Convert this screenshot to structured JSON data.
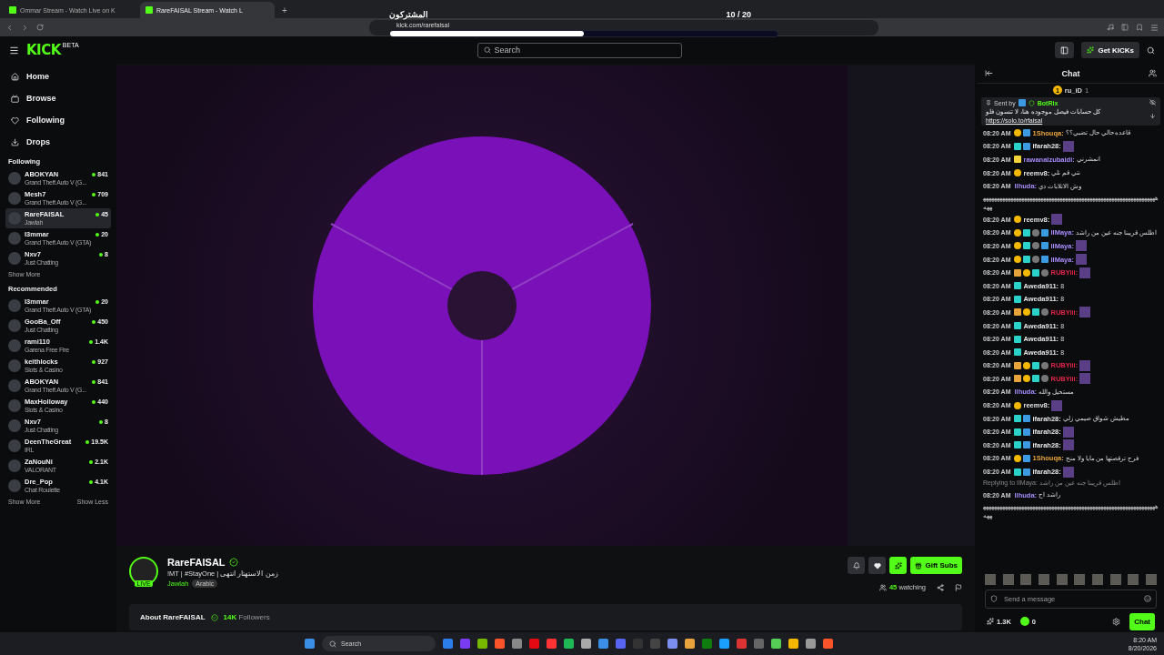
{
  "browser": {
    "tabs": [
      {
        "title": "Ommar Stream - Watch Live on K",
        "selected": false
      },
      {
        "title": "RareFAISAL Stream - Watch L",
        "selected": true
      }
    ],
    "new_tab": "+",
    "url": "kick.com/rarefaisal"
  },
  "overlay": {
    "label": "المشتركون",
    "count": "10 / 20",
    "level": 0.5
  },
  "header": {
    "logo": "KICK",
    "logo_tag": "BETA",
    "search": {
      "placeholder": "Search"
    },
    "get_kicks": "Get KICKs"
  },
  "sidebar": {
    "nav": [
      {
        "label": "Home"
      },
      {
        "label": "Browse"
      },
      {
        "label": "Following"
      },
      {
        "label": "Drops"
      }
    ],
    "following_title": "Following",
    "following": [
      {
        "name": "ABOKYAN",
        "category": "Grand Theft Auto V (G...",
        "viewers": "841",
        "selected": false
      },
      {
        "name": "Mesh7",
        "category": "Grand Theft Auto V (G...",
        "viewers": "709",
        "selected": false
      },
      {
        "name": "RareFAISAL",
        "category": "Jawlah",
        "viewers": "45",
        "selected": true
      },
      {
        "name": "I3mmar",
        "category": "Grand Theft Auto V (GTA)",
        "viewers": "20",
        "selected": false
      },
      {
        "name": "Nxv7",
        "category": "Just Chatting",
        "viewers": "8",
        "selected": false
      }
    ],
    "following_more": "Show More",
    "recommended_title": "Recommended",
    "recommended": [
      {
        "name": "I3mmar",
        "category": "Grand Theft Auto V (GTA)",
        "viewers": "20",
        "selected": false
      },
      {
        "name": "GooBa_Off",
        "category": "Just Chatting",
        "viewers": "450",
        "selected": false
      },
      {
        "name": "rami110",
        "category": "Garena Free Fire",
        "viewers": "1.4K",
        "selected": false
      },
      {
        "name": "keithlocks",
        "category": "Slots & Casino",
        "viewers": "927",
        "selected": false
      },
      {
        "name": "ABOKYAN",
        "category": "Grand Theft Auto V (G...",
        "viewers": "841",
        "selected": false
      },
      {
        "name": "MaxHolloway",
        "category": "Slots & Casino",
        "viewers": "440",
        "selected": false
      },
      {
        "name": "Nxv7",
        "category": "Just Chatting",
        "viewers": "8",
        "selected": false
      },
      {
        "name": "DeenTheGreat",
        "category": "IRL",
        "viewers": "19.5K",
        "selected": false
      },
      {
        "name": "ZaNouNi",
        "category": "VALORANT",
        "viewers": "2.1K",
        "selected": false
      },
      {
        "name": "Dre_Pop",
        "category": "Chat Roulette",
        "viewers": "4.1K",
        "selected": false
      }
    ],
    "show_more": "Show More",
    "show_less": "Show Less"
  },
  "channel": {
    "name": "RareFAISAL",
    "live_badge": "LIVE",
    "title": "!MT | #StayOne | زمن الاستهتار انتهى",
    "category": "Jawlah",
    "tag": "Arabic",
    "gift_subs": "Gift Subs",
    "watching_count": "45",
    "watching_label": "watching",
    "about_title": "About RareFAISAL",
    "followers_count": "14K",
    "followers_label": "Followers"
  },
  "chat": {
    "title": "Chat",
    "leader": {
      "rank": "1",
      "name": "ru_iD",
      "count": "1"
    },
    "pinned": {
      "sent_by": "Sent by",
      "author": "BotRix",
      "text": "كل حسابات فيصل موجوده هنا، لا تنسون فلو",
      "link": "https://solo.to/rfaisal"
    },
    "messages": [
      {
        "kind": "chat",
        "time": "08:20 AM",
        "badges": [
          {
            "kind": "sub"
          },
          {
            "kind": "mod"
          }
        ],
        "user": "1Shouqa:",
        "color": "#e8a33d",
        "text": "قاعده حالي حال تضبي؟؟"
      },
      {
        "kind": "chat",
        "time": "08:20 AM",
        "badges": [
          {
            "kind": "og"
          },
          {
            "kind": "mod"
          }
        ],
        "user": "ifarah28:",
        "color": "#e6e6e6",
        "emote": true
      },
      {
        "kind": "chat",
        "time": "08:20 AM",
        "badges": [
          {
            "kind": "vip"
          }
        ],
        "user": "rawanalzubaidi:",
        "color": "#a78bfa",
        "text": "انمشرني"
      },
      {
        "kind": "chat",
        "time": "08:20 AM",
        "badges": [
          {
            "kind": "sub"
          }
        ],
        "user": "reemv8:",
        "color": "#e6e6e6",
        "text": "نتي قم نلي"
      },
      {
        "kind": "chat",
        "time": "08:20 AM",
        "user": "llhuda:",
        "color": "#a78bfa",
        "text": "وش الاتلابات دي"
      },
      {
        "kind": "plain",
        "text": "ههههههههههههههههههههههههههههههههههههههههههههههههههههههههههههههههههه"
      },
      {
        "kind": "chat",
        "time": "08:20 AM",
        "badges": [
          {
            "kind": "sub"
          }
        ],
        "user": "reemv8:",
        "color": "#e6e6e6",
        "emote": true
      },
      {
        "kind": "chat",
        "time": "08:20 AM",
        "badges": [
          {
            "kind": "sub"
          },
          {
            "kind": "og"
          },
          {
            "kind": "hat"
          },
          {
            "kind": "mod"
          }
        ],
        "user": "IIMaya:",
        "color": "#a78bfa",
        "text": "اطلس قريبنا جنه عين من راشد"
      },
      {
        "kind": "chat",
        "time": "08:20 AM",
        "badges": [
          {
            "kind": "sub"
          },
          {
            "kind": "og"
          },
          {
            "kind": "hat"
          },
          {
            "kind": "mod"
          }
        ],
        "user": "IIMaya:",
        "color": "#a78bfa",
        "emote": true
      },
      {
        "kind": "chat",
        "time": "08:20 AM",
        "badges": [
          {
            "kind": "sub"
          },
          {
            "kind": "og"
          },
          {
            "kind": "hat"
          },
          {
            "kind": "mod"
          }
        ],
        "user": "IIMaya:",
        "color": "#a78bfa",
        "emote": true
      },
      {
        "kind": "chat",
        "time": "08:20 AM",
        "badges": [
          {
            "kind": "crown"
          },
          {
            "kind": "sub"
          },
          {
            "kind": "og"
          },
          {
            "kind": "hat"
          }
        ],
        "user": "RUBYiii:",
        "color": "#e0264a",
        "emote": true
      },
      {
        "kind": "chat",
        "time": "08:20 AM",
        "badges": [
          {
            "kind": "tw"
          }
        ],
        "user": "Aweda911:",
        "color": "#e6e6e6",
        "text": "8"
      },
      {
        "kind": "chat",
        "time": "08:20 AM",
        "badges": [
          {
            "kind": "tw"
          }
        ],
        "user": "Aweda911:",
        "color": "#e6e6e6",
        "text": "8"
      },
      {
        "kind": "chat",
        "time": "08:20 AM",
        "badges": [
          {
            "kind": "crown"
          },
          {
            "kind": "sub"
          },
          {
            "kind": "og"
          },
          {
            "kind": "hat"
          }
        ],
        "user": "RUBYiii:",
        "color": "#e0264a",
        "emote": true
      },
      {
        "kind": "chat",
        "time": "08:20 AM",
        "badges": [
          {
            "kind": "tw"
          }
        ],
        "user": "Aweda911:",
        "color": "#e6e6e6",
        "text": "8"
      },
      {
        "kind": "chat",
        "time": "08:20 AM",
        "badges": [
          {
            "kind": "tw"
          }
        ],
        "user": "Aweda911:",
        "color": "#e6e6e6",
        "text": "8"
      },
      {
        "kind": "chat",
        "time": "08:20 AM",
        "badges": [
          {
            "kind": "tw"
          }
        ],
        "user": "Aweda911:",
        "color": "#e6e6e6",
        "text": "8"
      },
      {
        "kind": "chat",
        "time": "08:20 AM",
        "badges": [
          {
            "kind": "crown"
          },
          {
            "kind": "sub"
          },
          {
            "kind": "og"
          },
          {
            "kind": "hat"
          }
        ],
        "user": "RUBYiii:",
        "color": "#e0264a",
        "emote": true
      },
      {
        "kind": "chat",
        "time": "08:20 AM",
        "badges": [
          {
            "kind": "crown"
          },
          {
            "kind": "sub"
          },
          {
            "kind": "og"
          },
          {
            "kind": "hat"
          }
        ],
        "user": "RUBYiii:",
        "color": "#e0264a",
        "emote": true
      },
      {
        "kind": "chat",
        "time": "08:20 AM",
        "user": "llhuda:",
        "color": "#a78bfa",
        "text": "مستحيل والله"
      },
      {
        "kind": "chat",
        "time": "08:20 AM",
        "badges": [
          {
            "kind": "sub"
          }
        ],
        "user": "reemv8:",
        "color": "#e6e6e6",
        "emote": true
      },
      {
        "kind": "chat",
        "time": "08:20 AM",
        "badges": [
          {
            "kind": "og"
          },
          {
            "kind": "mod"
          }
        ],
        "user": "ifarah28:",
        "color": "#e6e6e6",
        "text": "مطيش شواق صيمي زلي"
      },
      {
        "kind": "chat",
        "time": "08:20 AM",
        "badges": [
          {
            "kind": "og"
          },
          {
            "kind": "mod"
          }
        ],
        "user": "ifarah28:",
        "color": "#e6e6e6",
        "emote": true
      },
      {
        "kind": "chat",
        "time": "08:20 AM",
        "badges": [
          {
            "kind": "og"
          },
          {
            "kind": "mod"
          }
        ],
        "user": "ifarah28:",
        "color": "#e6e6e6",
        "emote": true
      },
      {
        "kind": "chat",
        "time": "08:20 AM",
        "badges": [
          {
            "kind": "sub"
          },
          {
            "kind": "mod"
          }
        ],
        "user": "1Shouqa:",
        "color": "#e8a33d",
        "text": "فرح ترقصتها من مايا ولا منح"
      },
      {
        "kind": "chat",
        "time": "08:20 AM",
        "badges": [
          {
            "kind": "og"
          },
          {
            "kind": "mod"
          }
        ],
        "user": "ifarah28:",
        "color": "#e6e6e6",
        "emote": true
      },
      {
        "kind": "reply",
        "text": "Replying to IIMaya: اطلس قريبنا جنه عين من راشد"
      },
      {
        "kind": "chat",
        "time": "08:20 AM",
        "user": "llhuda:",
        "color": "#a78bfa",
        "text": "راشد اح"
      },
      {
        "kind": "plain",
        "text": "ههههههههههههههههههههههههههههههههههههههههههههههههههههههههههههههههههه"
      }
    ],
    "input": {
      "placeholder": "Send a message"
    },
    "kicks": "1.3K",
    "points": "0",
    "send": "Chat"
  },
  "taskbar": {
    "search": {
      "placeholder": "Search"
    },
    "time": "8:20 AM",
    "date": "8/20/2026"
  }
}
